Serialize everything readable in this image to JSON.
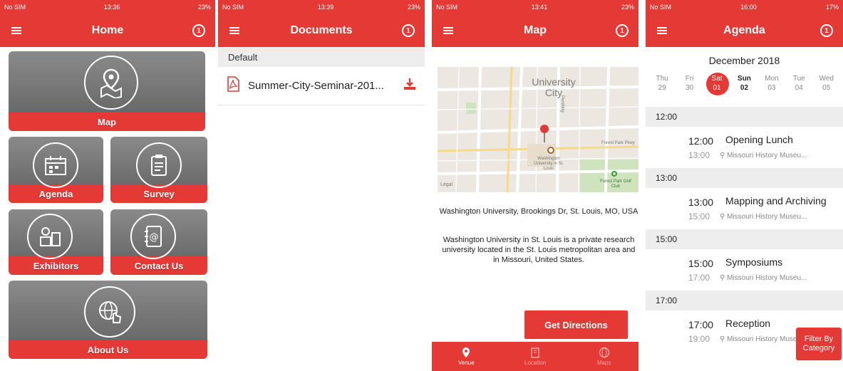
{
  "colors": {
    "accent": "#e53935",
    "tile": "#707070"
  },
  "status": [
    {
      "carrier": "No SIM",
      "time": "13:36",
      "battery": "23%"
    },
    {
      "carrier": "No SIM",
      "time": "13:39",
      "battery": "23%"
    },
    {
      "carrier": "No SIM",
      "time": "13:41",
      "battery": "23%"
    },
    {
      "carrier": "No SIM",
      "time": "16:00",
      "battery": "17%"
    }
  ],
  "home": {
    "title": "Home",
    "tiles": {
      "map": "Map",
      "agenda": "Agenda",
      "survey": "Survey",
      "exhibitors": "Exhibitors",
      "contact": "Contact Us",
      "about": "About Us"
    }
  },
  "documents": {
    "title": "Documents",
    "section": "Default",
    "file": "Summer-City-Seminar-201..."
  },
  "map": {
    "title": "Map",
    "map_labels": {
      "area": "University City",
      "place": "Washington University in St. Louis",
      "park": "Forest Park Golf Club",
      "street1": "Forest Park Pkwy",
      "street2": "Pershing",
      "watermark": "Legal"
    },
    "address": "Washington University, Brookings Dr, St. Louis, MO, USA",
    "description": "Washington University in St. Louis is a private research university located in the St. Louis metropolitan area and in Missouri, United States.",
    "directions": "Get Directions",
    "tabs": [
      "Venue",
      "Location",
      "Maps"
    ]
  },
  "agenda": {
    "title": "Agenda",
    "month": "December 2018",
    "days": [
      {
        "dow": "Thu",
        "num": "29"
      },
      {
        "dow": "Fri",
        "num": "30"
      },
      {
        "dow": "Sat",
        "num": "01"
      },
      {
        "dow": "Sun",
        "num": "02"
      },
      {
        "dow": "Mon",
        "num": "03"
      },
      {
        "dow": "Tue",
        "num": "04"
      },
      {
        "dow": "Wed",
        "num": "05"
      }
    ],
    "groups": [
      {
        "header": "12:00",
        "start": "12:00",
        "end": "13:00",
        "title": "Opening Lunch",
        "location": "Missouri History Museu..."
      },
      {
        "header": "13:00",
        "start": "13:00",
        "end": "15:00",
        "title": "Mapping and Archiving",
        "location": "Missouri History Museu..."
      },
      {
        "header": "15:00",
        "start": "15:00",
        "end": "17:00",
        "title": "Symposiums",
        "location": "Missouri History Museu..."
      },
      {
        "header": "17:00",
        "start": "17:00",
        "end": "19:00",
        "title": "Reception",
        "location": "Missouri History Museu..."
      }
    ],
    "filter": "Filter By Category"
  }
}
